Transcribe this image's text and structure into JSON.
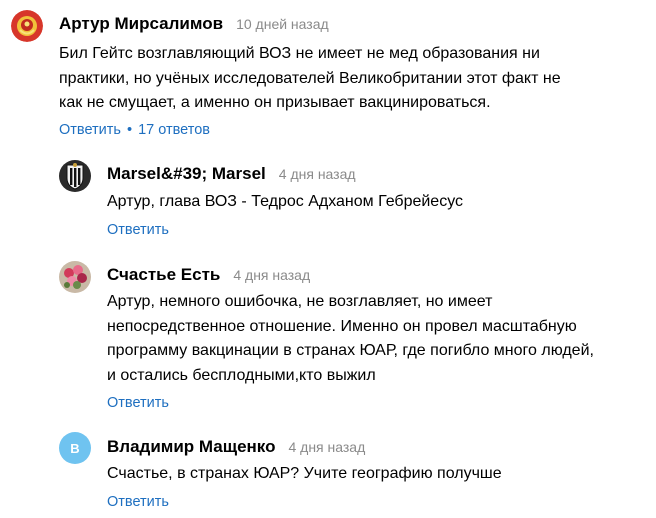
{
  "comments": [
    {
      "author": "Артур Мирсалимов",
      "time": "10 дней назад",
      "avatar_icon": "red-emblem-avatar",
      "lines": [
        "Бил Гейтс возглавляющий ВОЗ не имеет не мед образования ни",
        "практики, но учёных исследователей Великобритании этот факт не",
        "как не смущает, а именно он призывает вакцинироваться."
      ],
      "reply_label": "Ответить",
      "separator": "•",
      "replies_label": "17 ответов"
    },
    {
      "author": "Marsel&#39; Marsel",
      "time": "4 дня назад",
      "avatar_icon": "juventus-logo-avatar",
      "lines": [
        "Артур, глава ВОЗ - Тедрос Адханом Гебрейесус"
      ],
      "reply_label": "Ответить"
    },
    {
      "author": "Счастье Есть",
      "time": "4 дня назад",
      "avatar_icon": "flowers-photo-avatar",
      "lines": [
        "Артур, немного ошибочка, не возглавляет, но имеет",
        "непосредственное отношение. Именно он провел масштабную",
        "программу вакцинации в странах ЮАР, где погибло много людей,",
        "и остались бесплодными,кто выжил"
      ],
      "reply_label": "Ответить"
    },
    {
      "author": "Владимир Мащенко",
      "time": "4 дня назад",
      "avatar_icon": "letter-avatar",
      "avatar_letter": "В",
      "lines": [
        "Счастье, в странах ЮАР? Учите географию получше"
      ],
      "reply_label": "Ответить"
    }
  ],
  "colors": {
    "link": "#1e6fc0",
    "time": "#8a8a8a",
    "letter_avatar_bg": "#6fc3f0"
  }
}
